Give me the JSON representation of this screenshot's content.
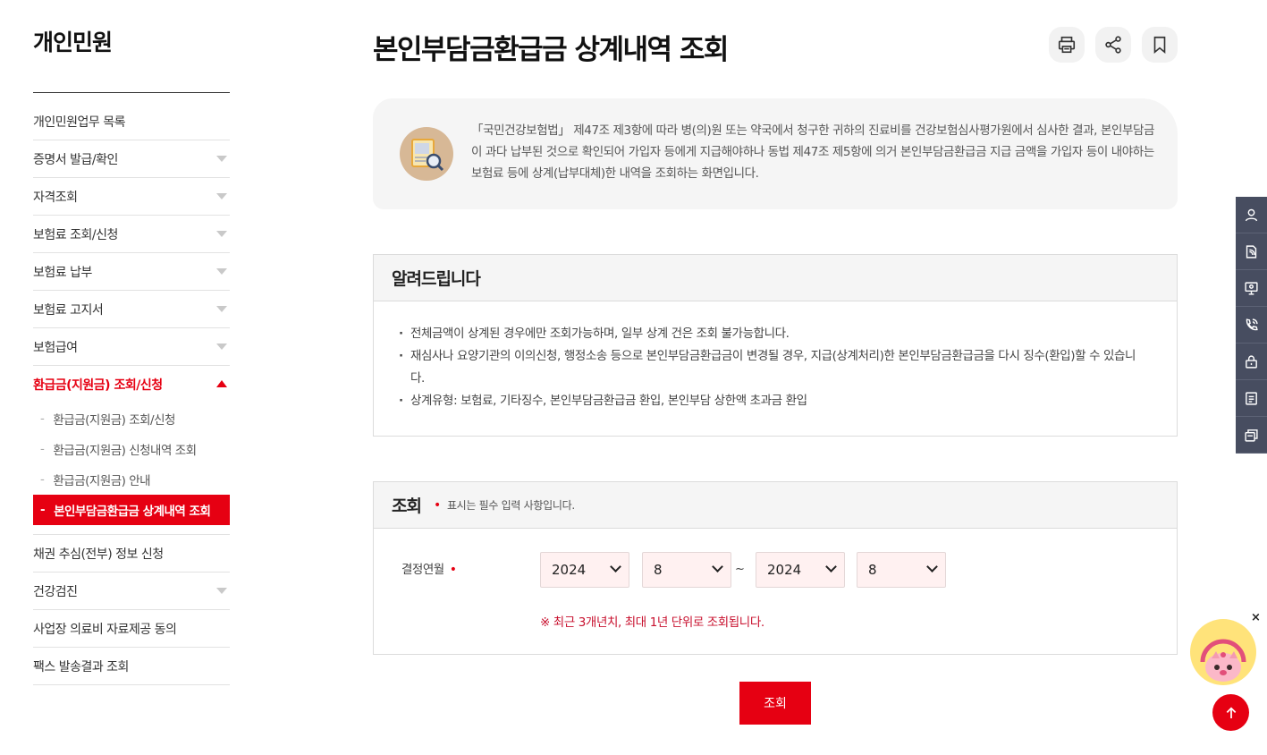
{
  "sidebar": {
    "title": "개인민원",
    "items": [
      {
        "label": "개인민원업무 목록"
      },
      {
        "label": "증명서 발급/확인"
      },
      {
        "label": "자격조회"
      },
      {
        "label": "보험료 조회/신청"
      },
      {
        "label": "보험료 납부"
      },
      {
        "label": "보험료 고지서"
      },
      {
        "label": "보험급여"
      },
      {
        "label": "환급금(지원금) 조회/신청"
      },
      {
        "label": "채권 추심(전부) 정보 신청"
      },
      {
        "label": "건강검진"
      },
      {
        "label": "사업장 의료비 자료제공 동의"
      },
      {
        "label": "팩스 발송결과 조회"
      }
    ],
    "sub_items": [
      {
        "label": "환급금(지원금) 조회/신청"
      },
      {
        "label": "환급금(지원금) 신청내역 조회"
      },
      {
        "label": "환급금(지원금) 안내"
      },
      {
        "label": "본인부담금환급금 상계내역 조회"
      }
    ],
    "dash": "-"
  },
  "page": {
    "title": "본인부담금환급금 상계내역 조회"
  },
  "toolbar": {
    "icons": [
      "print-icon",
      "share-icon",
      "bookmark-icon"
    ]
  },
  "intro": {
    "text": "「국민건강보험법」 제47조 제3항에 따라 병(의)원 또는 약국에서 청구한 귀하의 진료비를 건강보험심사평가원에서 심사한 결과, 본인부담금이 과다 납부된 것으로 확인되어 가입자 등에게 지급해야하나 동법 제47조 제5항에 의거 본인부담금환급금 지급 금액을 가입자 등이 내야하는 보험료 등에 상계(납부대체)한 내역을 조회하는 화면입니다."
  },
  "notice": {
    "title": "알려드립니다",
    "items": [
      "전체금액이 상계된 경우에만 조회가능하며, 일부 상계 건은 조회 불가능합니다.",
      "재심사나 요양기관의 이의신청, 행정소송 등으로 본인부담금환급금이 변경될 경우, 지급(상계처리)한 본인부담금환급금을 다시 징수(환입)할 수 있습니다.",
      "상계유형: 보험료, 기타징수, 본인부담금환급금 환입, 본인부담 상한액 초과금 환입"
    ]
  },
  "query": {
    "title": "조회",
    "required_dot": "•",
    "required_note": "표시는 필수 입력 사항입니다.",
    "field_label": "결정연월",
    "from_year": "2024",
    "from_month": "8",
    "separator": "~",
    "to_year": "2024",
    "to_month": "8",
    "hint": "※ 최근 3개년치, 최대 1년 단위로 조회됩니다.",
    "submit_label": "조회"
  },
  "quickbar": {
    "icons": [
      "user-icon",
      "document-icon",
      "monitor-icon",
      "phone-icon",
      "lock-icon",
      "list-icon",
      "copy-icon"
    ]
  },
  "float": {
    "close": "×"
  },
  "colors": {
    "accent": "#e60012",
    "quickbar": "#474d60",
    "panel": "#f5f5f5"
  }
}
